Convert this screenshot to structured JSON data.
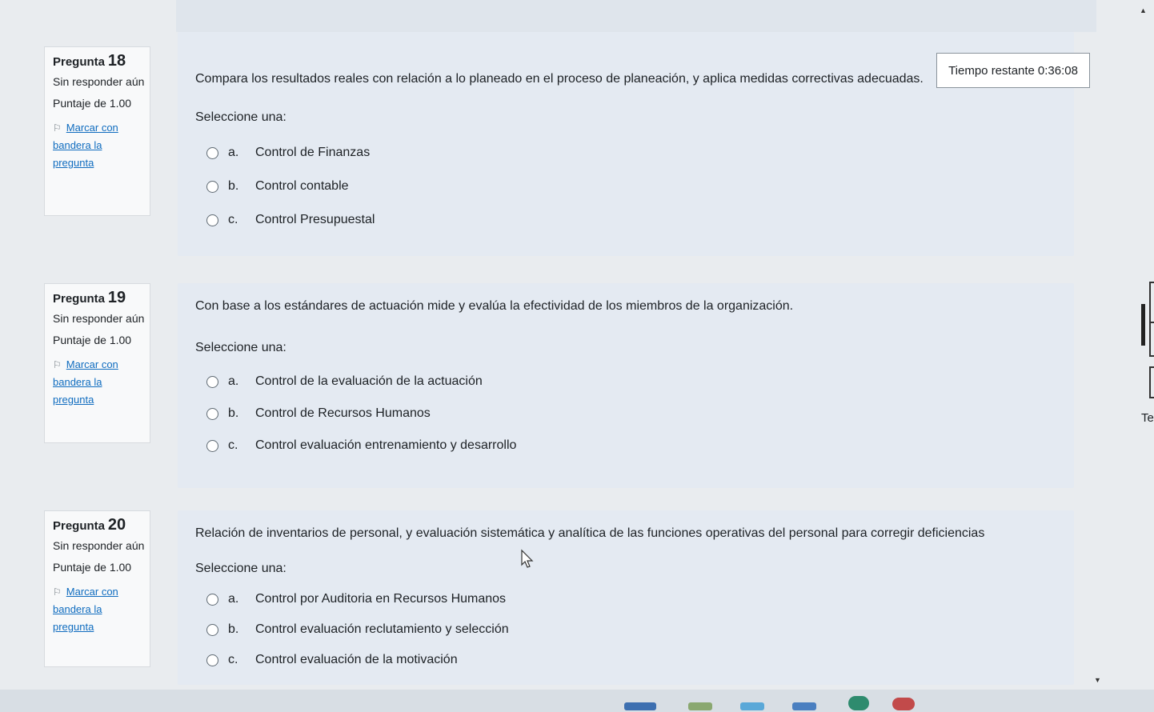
{
  "timer": {
    "label": "Tiempo restante",
    "value": "0:36:08"
  },
  "questions": [
    {
      "label": "Pregunta",
      "number": "18",
      "state": "Sin responder aún",
      "grade": "Puntaje de 1.00",
      "flag": "Marcar con bandera la pregunta",
      "text": "Compara los resultados reales con relación a lo planeado en el proceso de planeación, y aplica medidas correctivas adecuadas.",
      "prompt": "Seleccione una:",
      "answers": [
        {
          "letter": "a.",
          "text": "Control de Finanzas"
        },
        {
          "letter": "b.",
          "text": "Control contable"
        },
        {
          "letter": "c.",
          "text": "Control Presupuestal"
        }
      ]
    },
    {
      "label": "Pregunta",
      "number": "19",
      "state": "Sin responder aún",
      "grade": "Puntaje de 1.00",
      "flag": "Marcar con bandera la pregunta",
      "text": "Con base a los estándares de actuación mide y evalúa la efectividad de los miembros de la organización.",
      "prompt": "Seleccione una:",
      "answers": [
        {
          "letter": "a.",
          "text": "Control de la evaluación de la actuación"
        },
        {
          "letter": "b.",
          "text": "Control de Recursos Humanos"
        },
        {
          "letter": "c.",
          "text": "Control evaluación entrenamiento y desarrollo"
        }
      ]
    },
    {
      "label": "Pregunta",
      "number": "20",
      "state": "Sin responder aún",
      "grade": "Puntaje de 1.00",
      "flag": "Marcar con bandera la pregunta",
      "text": "Relación de inventarios de personal, y evaluación sistemática y analítica de las funciones operativas del personal para corregir deficiencias",
      "prompt": "Seleccione una:",
      "answers": [
        {
          "letter": "a.",
          "text": "Control por Auditoria en Recursos Humanos"
        },
        {
          "letter": "b.",
          "text": "Control evaluación reclutamiento y selección"
        },
        {
          "letter": "c.",
          "text": "Control evaluación de la motivación"
        }
      ]
    }
  ],
  "side_text": "Te",
  "colors": {
    "link": "#0f6cbf",
    "content_bg": "#e4eaf2",
    "info_bg": "#f8f9fa"
  }
}
